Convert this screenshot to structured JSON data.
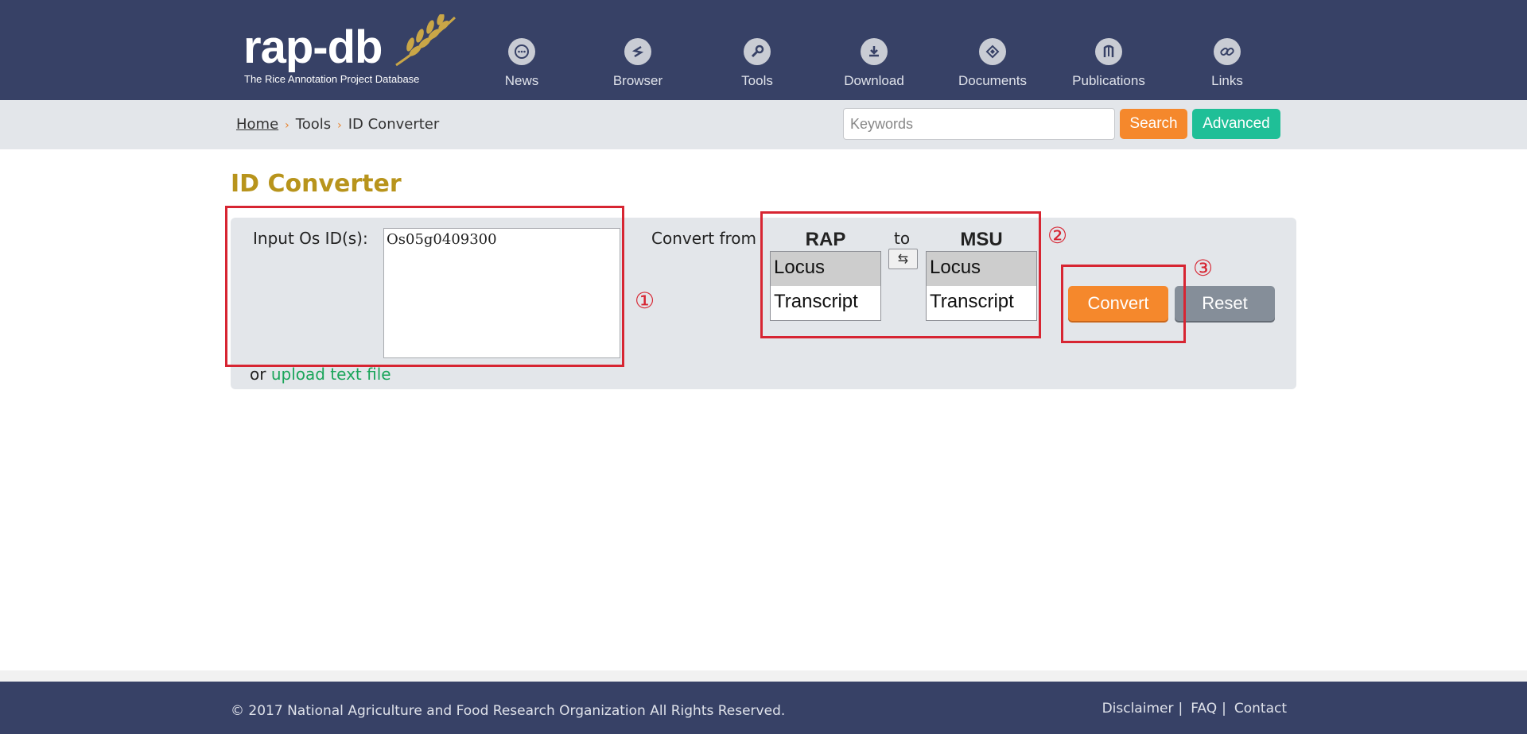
{
  "logo": {
    "text": "rap-db",
    "subtitle": "The Rice Annotation Project Database"
  },
  "nav": [
    {
      "label": "News",
      "icon": "chat-bubble-icon"
    },
    {
      "label": "Browser",
      "icon": "browser-icon"
    },
    {
      "label": "Tools",
      "icon": "wrench-icon"
    },
    {
      "label": "Download",
      "icon": "download-icon"
    },
    {
      "label": "Documents",
      "icon": "documents-icon"
    },
    {
      "label": "Publications",
      "icon": "book-icon"
    },
    {
      "label": "Links",
      "icon": "link-icon"
    }
  ],
  "breadcrumb": {
    "home": "Home",
    "tools": "Tools",
    "current": "ID Converter",
    "separator": "›"
  },
  "search": {
    "placeholder": "Keywords",
    "value": "",
    "search_label": "Search",
    "advanced_label": "Advanced"
  },
  "main": {
    "title": "ID Converter",
    "input_label": "Input Os ID(s):",
    "input_value": "Os05g0409300",
    "or_text": "or",
    "upload_link": "upload text file",
    "convert_from_label": "Convert from",
    "source": {
      "name": "RAP",
      "options": [
        "Locus",
        "Transcript"
      ],
      "selected": "Locus"
    },
    "to_label": "to",
    "swap_label": "⇆",
    "target": {
      "name": "MSU",
      "options": [
        "Locus",
        "Transcript"
      ],
      "selected": "Locus"
    },
    "convert_label": "Convert",
    "reset_label": "Reset"
  },
  "annotations": {
    "one": "①",
    "two": "②",
    "three": "③"
  },
  "footer": {
    "copyright": "© 2017 National Agriculture and Food Research Organization All Rights Reserved.",
    "links": [
      "Disclaimer",
      "FAQ",
      "Contact"
    ],
    "separator": "|"
  },
  "colors": {
    "header_bg": "#374166",
    "title": "#b8941c",
    "accent_orange": "#f5882c",
    "accent_teal": "#1fbf97",
    "link_green": "#1aa55a",
    "annotation_red": "#d72532"
  }
}
